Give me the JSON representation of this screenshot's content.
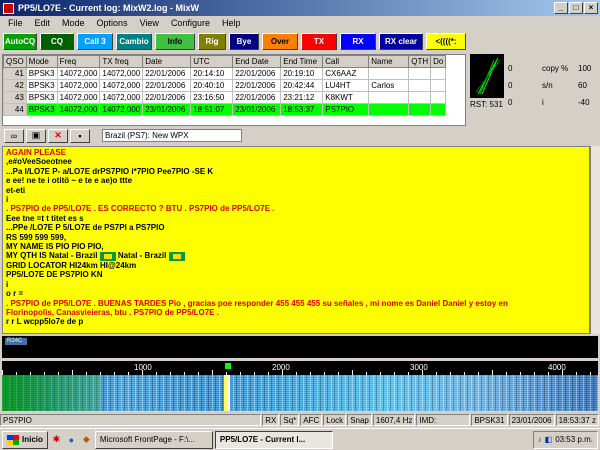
{
  "window": {
    "title": "PP5/LO7E - Current log: MixW2.log - MixW"
  },
  "menu": [
    "File",
    "Edit",
    "Mode",
    "Options",
    "View",
    "Configure",
    "Help"
  ],
  "macros": [
    {
      "label": "AutoCQ",
      "bg": "#00a000",
      "fg": "#ffffff"
    },
    {
      "label": "CQ",
      "bg": "#006000",
      "fg": "#ffffff"
    },
    {
      "label": "Call 3",
      "bg": "#00a0ff",
      "fg": "#ffffff"
    },
    {
      "label": "Cambio",
      "bg": "#008080",
      "fg": "#ffffff"
    },
    {
      "label": "Info",
      "bg": "#40c040",
      "fg": "#000000"
    },
    {
      "label": "Rig",
      "bg": "#808000",
      "fg": "#ffffff"
    },
    {
      "label": "Bye",
      "bg": "#000080",
      "fg": "#ffffff"
    },
    {
      "label": "Over",
      "bg": "#ff8000",
      "fg": "#000000"
    },
    {
      "label": "TX",
      "bg": "#ff0000",
      "fg": "#ffffff"
    },
    {
      "label": "RX",
      "bg": "#0000ff",
      "fg": "#ffffff"
    },
    {
      "label": "RX clear",
      "bg": "#0000a0",
      "fg": "#ffffff"
    },
    {
      "label": "<((((*:",
      "bg": "#ffff00",
      "fg": "#000000"
    }
  ],
  "log": {
    "headers": [
      "QSO",
      "Mode",
      "Freq",
      "TX freq",
      "Date",
      "UTC",
      "End Date",
      "End Time",
      "Call",
      "Name",
      "QTH",
      "Do"
    ],
    "rows": [
      [
        "41",
        "BPSK3",
        "14072,000",
        "14072,000",
        "22/01/2006",
        "20:14:10",
        "22/01/2006",
        "20:19:10",
        "CX6AAZ",
        "",
        "",
        ""
      ],
      [
        "42",
        "BPSK3",
        "14072,000",
        "14072,000",
        "22/01/2006",
        "20:40:10",
        "22/01/2006",
        "20:42:44",
        "LU4HT",
        "Carlos",
        "",
        ""
      ],
      [
        "43",
        "BPSK3",
        "14072,000",
        "14072,000",
        "22/01/2006",
        "23:16:50",
        "22/01/2006",
        "23:21:12",
        "K8KWT",
        "",
        "",
        ""
      ],
      [
        "44",
        "BPSK3",
        "14072,000",
        "14072,000",
        "23/01/2006",
        "18:51:07",
        "23/01/2006",
        "18:53:37",
        "PS7PIO",
        "",
        "",
        ""
      ]
    ]
  },
  "tuner": {
    "rst": "RST: 531",
    "meters": [
      {
        "left": "0",
        "mid": "copy %",
        "right": "100"
      },
      {
        "left": "0",
        "mid": "s/n",
        "right": "60"
      },
      {
        "left": "0",
        "mid": "i",
        "right": "-40"
      }
    ]
  },
  "toolbar": {
    "icons": [
      "glasses-icon",
      "frame-icon",
      "delete-icon",
      "save-icon"
    ],
    "contest_select": "Brazil (PS7):  New WPX"
  },
  "rx_lines": [
    {
      "color": "red",
      "text": "AGAIN PLEASE"
    },
    {
      "color": "blk",
      "text": " ,e#oVeeSoeotnee"
    },
    {
      "color": "blk",
      "text": "...Pa  I/LO7E P- a/LO7E drPS7PIO i*7PIO Pee7PIO -SE K"
    },
    {
      "color": "blk",
      "text": "e ee!  ne  te  i otitö ~ e te   e ae)o ttte"
    },
    {
      "color": "blk",
      "text": "et-eti"
    },
    {
      "color": "blk",
      "text": "i"
    },
    {
      "color": "red",
      "text": ". PS7PIO de PP5/LO7E .   ES CORRECTO ?   BTU . PS7PIO de PP5/LO7E ."
    },
    {
      "color": "blk",
      "text": "Eee  tne =t t titet es s"
    },
    {
      "color": "blk",
      "text": "...PPe  /LO7E P  5/LO7E de PS7PI a PS7PIO"
    },
    {
      "color": "blk",
      "text": "RS  599 599 599,"
    },
    {
      "color": "blk",
      "text": "MY NAME IS PIO PIO PIO,"
    },
    {
      "color": "blk",
      "text": "MY QTH IS Natal - Brazil [flag] Natal - Brazil [flag]"
    },
    {
      "color": "blk",
      "text": "GRID LOCATOR HI24km HI@24km"
    },
    {
      "color": "blk",
      "text": "PP5/LO7E DE PS7PIO KN"
    },
    {
      "color": "blk",
      "text": "i"
    },
    {
      "color": "blk",
      "text": " o r ="
    },
    {
      "color": "red",
      "text": ". PS7PIO de PP5/LO7E .  BUENAS TARDES Pio , gracias poe responder  455 455 455 su señales , mi nome es Daniel Daniel   y estoy en"
    },
    {
      "color": "red",
      "text": "Florinopolis,  Canasvieieras,   btu . PS7PIO de PP5/LO7E ."
    },
    {
      "color": "blk",
      "text": "r r   L wcpp5lo7e de p"
    }
  ],
  "tx": {
    "chip": "R24C"
  },
  "ruler": {
    "ticks": [
      "1000",
      "2000",
      "3000",
      "4000"
    ]
  },
  "status": {
    "call": "PS7PIO",
    "rx": "RX",
    "sq": "Sq*",
    "afc": "AFC",
    "lock": "Lock",
    "snap": "Snap",
    "freq": "1607,4 Hz",
    "imd": "IMD:",
    "mode": "BPSK31",
    "date": "23/01/2006",
    "time": "18:53:37 z"
  },
  "taskbar": {
    "start": "Inicio",
    "tasks": [
      {
        "label": "Microsoft FrontPage - F:\\...",
        "active": false
      },
      {
        "label": "PP5/LO7E - Current l...",
        "active": true
      }
    ],
    "clock": "03:53 p.m."
  },
  "colors": {
    "rx_bg": "#ffff00",
    "selected_row": "#00ff00",
    "red_text": "#e00000"
  }
}
